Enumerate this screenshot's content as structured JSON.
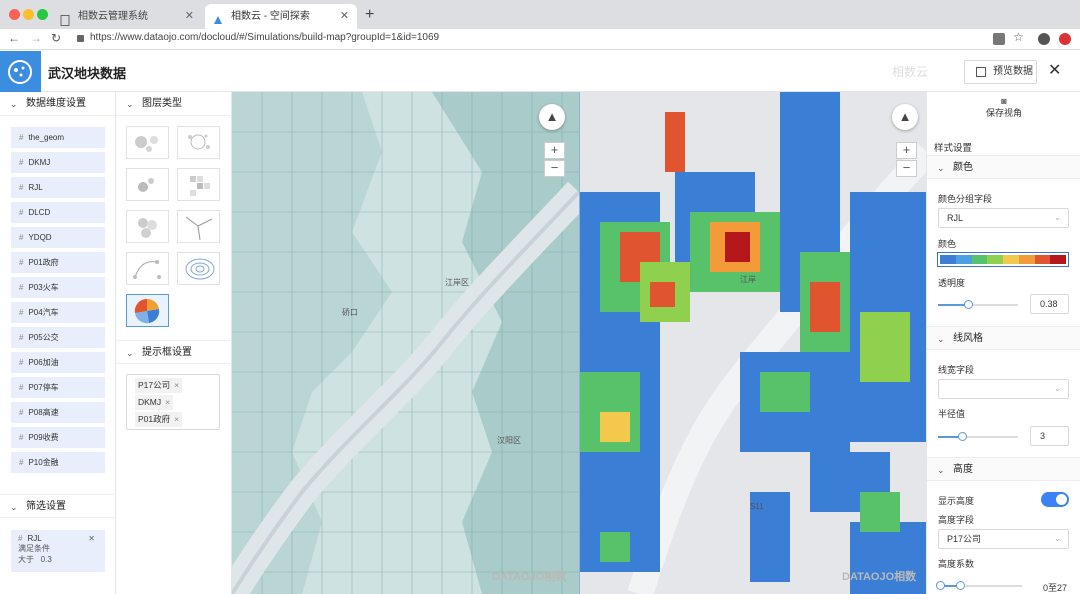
{
  "browser": {
    "tabs": [
      {
        "title": "相数云管理系统",
        "active": false
      },
      {
        "title": "相数云 - 空间探索",
        "active": true
      }
    ],
    "url": "https://www.dataojo.com/docloud/#/Simulations/build-map?groupId=1&id=1069"
  },
  "app": {
    "title": "武汉地块数据",
    "brand": "相数云",
    "preview_label": "预览数据"
  },
  "data_panel": {
    "title": "数据维度设置",
    "fields": [
      "the_geom",
      "DKMJ",
      "RJL",
      "DLCD",
      "YDQD",
      "P01政府",
      "P03火车",
      "P04汽车",
      "P05公交",
      "P06加油",
      "P07停车",
      "P08高速",
      "P09收费",
      "P10金融"
    ]
  },
  "filter_panel": {
    "title": "筛选设置",
    "field": "RJL",
    "cond_label": "满足条件",
    "op": "大于",
    "value": "0.3"
  },
  "layer_panel": {
    "title": "图层类型"
  },
  "tooltip_panel": {
    "title": "提示框设置",
    "tags": [
      "P17公司",
      "DKMJ",
      "P01政府"
    ]
  },
  "maps": {
    "labels_left": [
      "江岸区",
      "硚口",
      "汉阳区"
    ],
    "labels_right": [
      "江岸",
      "S11"
    ],
    "watermark": "DATAOJO相数"
  },
  "style_panel": {
    "save_view": "保存视角",
    "style_title": "样式设置",
    "color_section": "颜色",
    "color_group_label": "颜色分组字段",
    "color_group_value": "RJL",
    "color_label": "颜色",
    "colors": [
      "#3a7fd5",
      "#4aa0e0",
      "#57c26a",
      "#8fd14f",
      "#f2c94c",
      "#f29b38",
      "#e0542f",
      "#b5171a"
    ],
    "opacity_label": "透明度",
    "opacity_value": "0.38",
    "line_section": "线风格",
    "line_width_label": "线宽字段",
    "line_width_value": "",
    "radius_label": "半径值",
    "radius_value": "3",
    "height_section": "高度",
    "show_height_label": "显示高度",
    "show_height_on": true,
    "height_field_label": "高度字段",
    "height_field_value": "P17公司",
    "height_coef_label": "高度系数",
    "height_coef_value": "0至27"
  }
}
